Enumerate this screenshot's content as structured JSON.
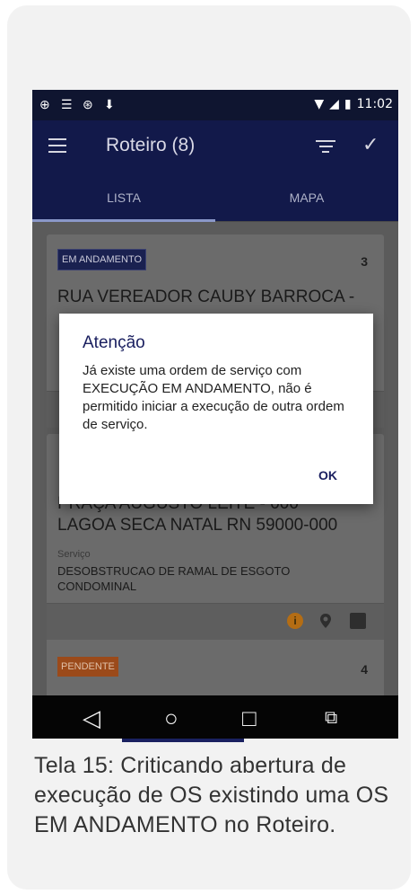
{
  "status_bar": {
    "time": "11:02"
  },
  "app_bar": {
    "title": "Roteiro (8)"
  },
  "tabs": [
    {
      "label": "LISTA"
    },
    {
      "label": "MAPA"
    }
  ],
  "orders": [
    {
      "badge": "EM ANDAMENTO",
      "number": "3",
      "address": "RUA VEREADOR CAUBY BARROCA -"
    },
    {
      "address_line1": "PRAÇA AUGUSTO LEITE - 000",
      "address_line2": "LAGOA SECA NATAL RN 59000-000",
      "service_label": "Serviço",
      "service_line1": "DESOBSTRUCAO DE RAMAL DE ESGOTO",
      "service_line2": "CONDOMINAL"
    },
    {
      "badge": "PENDENTE",
      "number": "4"
    }
  ],
  "dialog": {
    "title": "Atenção",
    "message": "Já existe uma ordem de serviço com EXECUÇÃO EM ANDAMENTO, não é permitido iniciar a execução de outra ordem de serviço.",
    "ok_label": "OK"
  },
  "caption": "Tela 15: Criticando abertura de execução de OS existindo uma OS EM ANDAMENTO no Roteiro.",
  "icons": {
    "menu": "menu-icon",
    "filter": "filter-icon",
    "check": "check-icon",
    "info": "info-icon",
    "pin": "location-pin-icon",
    "image": "image-icon",
    "back": "back-icon",
    "home": "home-icon",
    "recents": "recents-icon",
    "cast": "screen-cast-icon"
  },
  "colors": {
    "app_bar": "#12194a",
    "status_bar": "#0f1530",
    "badge_in_progress": "#1a2150",
    "badge_pending": "#d8570f",
    "accent": "#1b2060"
  }
}
